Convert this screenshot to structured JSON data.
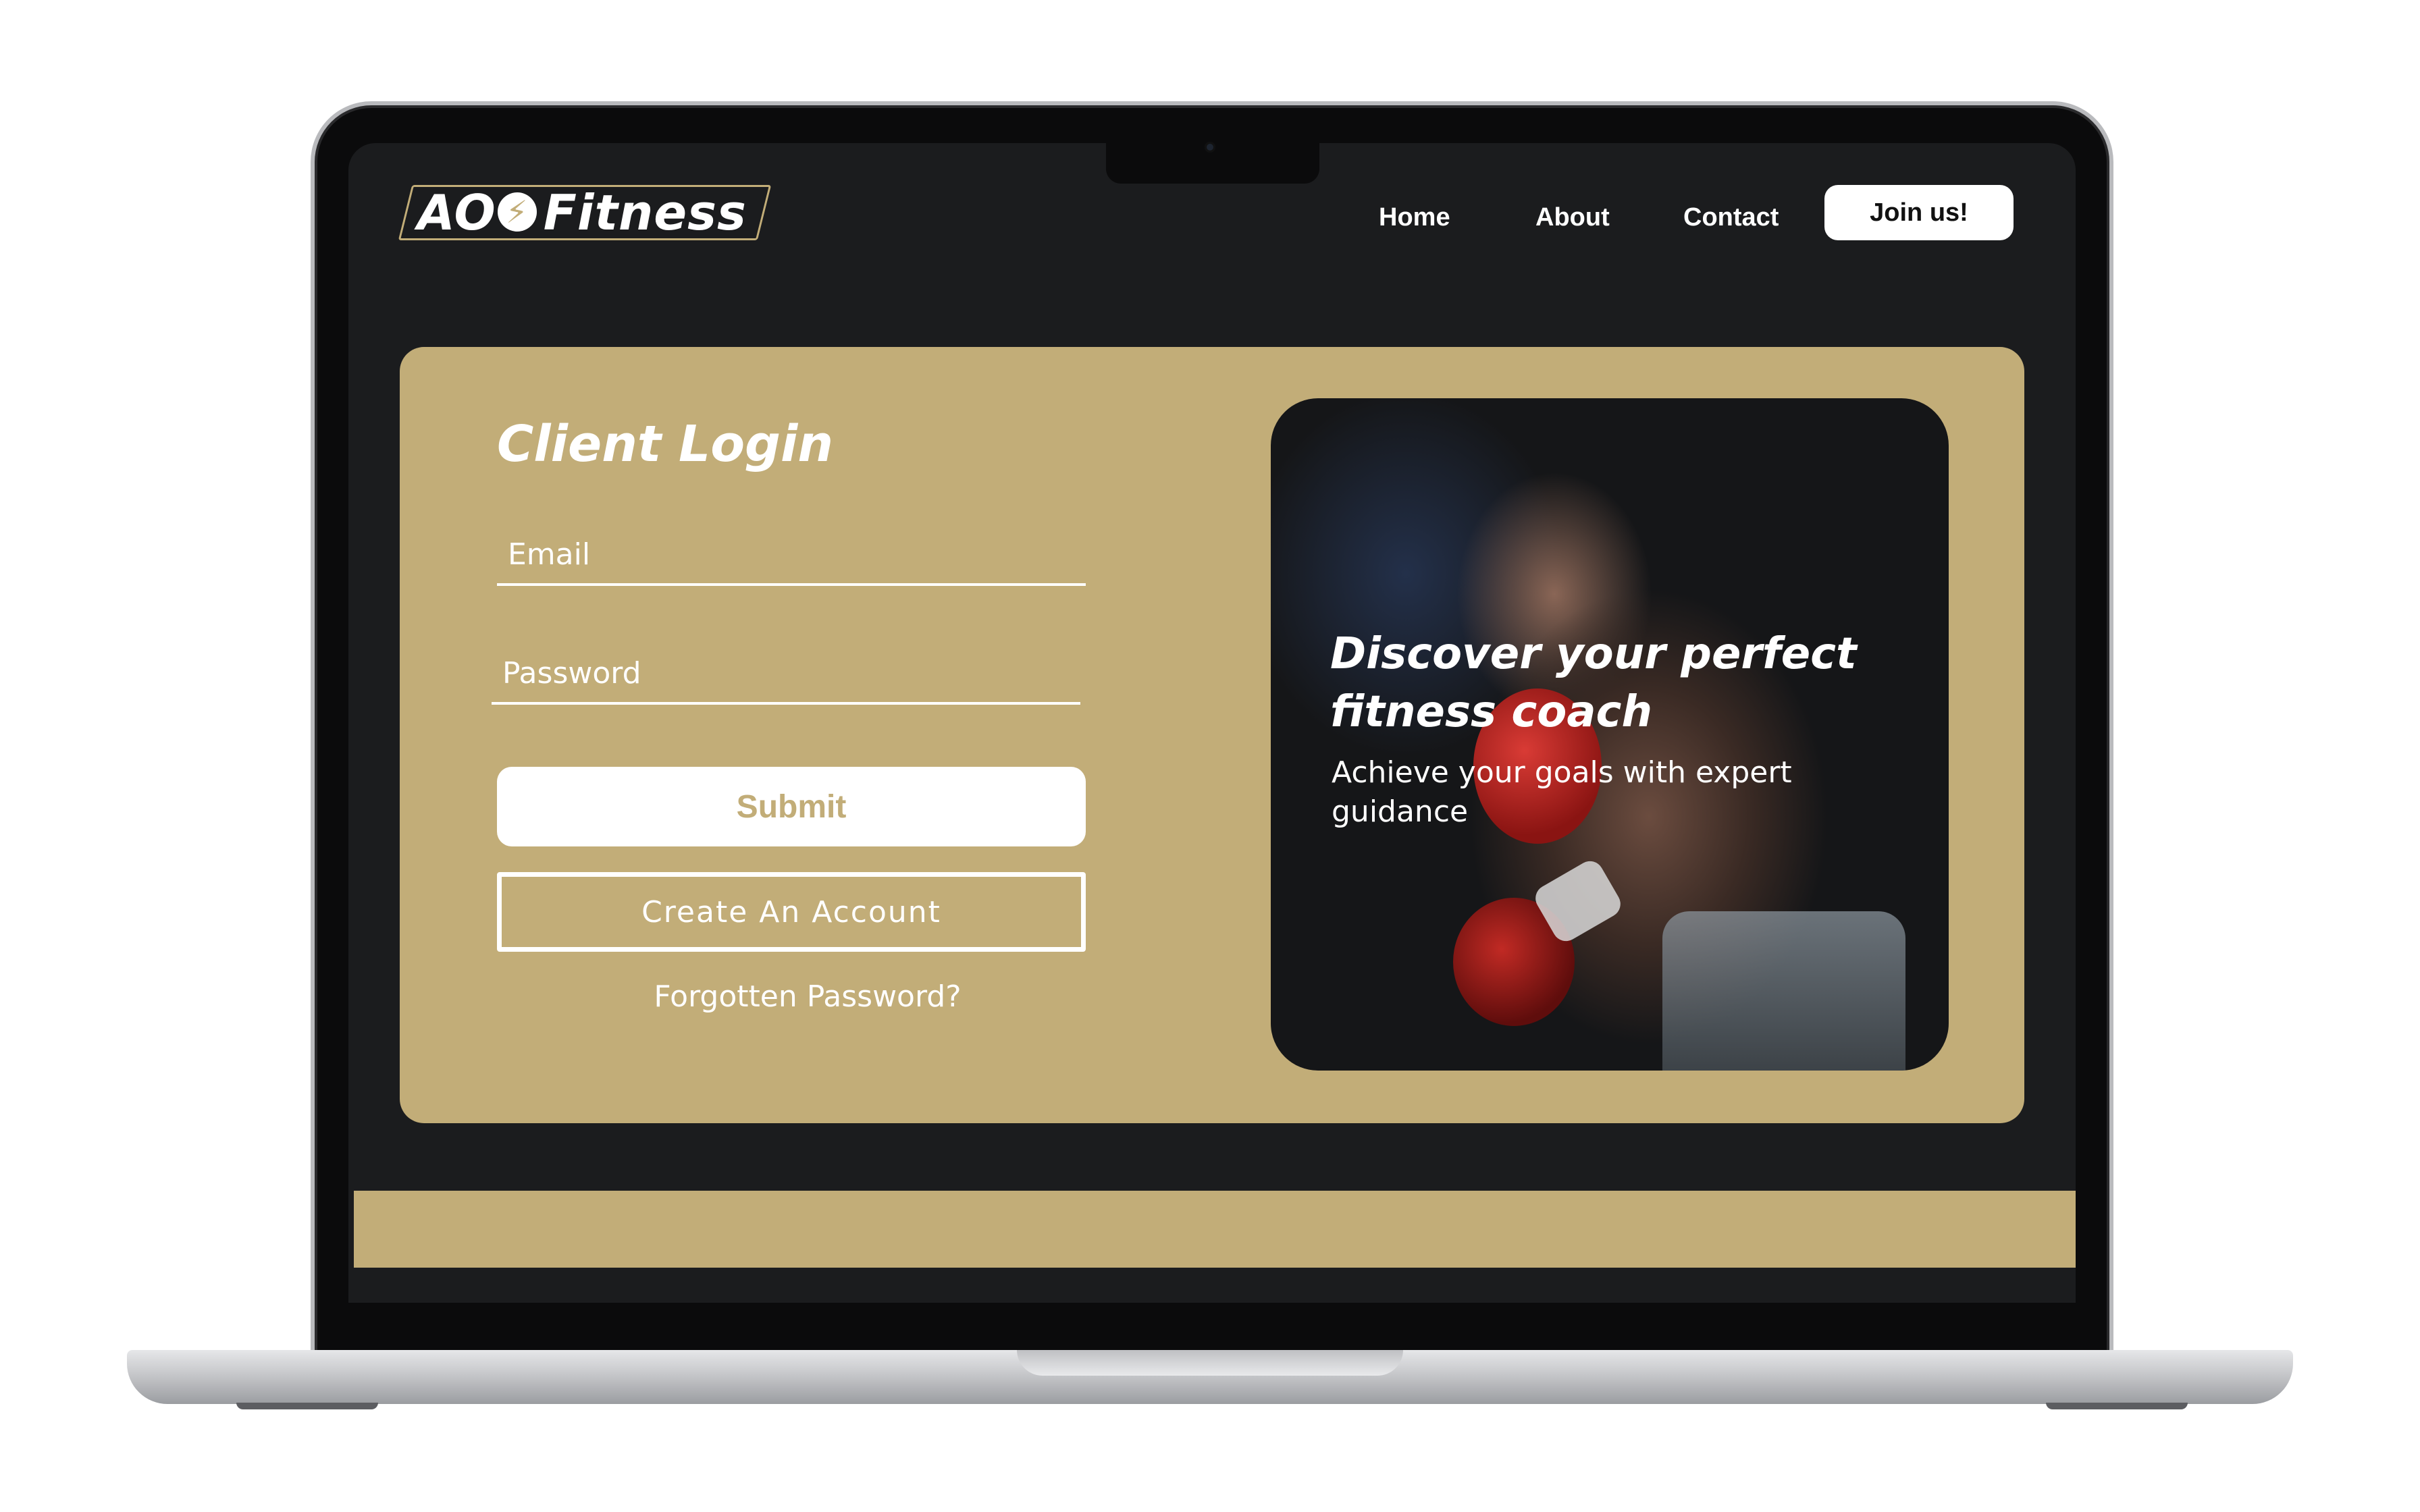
{
  "brand": {
    "logo_prefix": "AO",
    "logo_name": "Fitness",
    "accent_color": "#c2ad78",
    "background_color": "#1b1c1e",
    "bolt_icon": "lightning-bolt-icon"
  },
  "nav": {
    "items": [
      {
        "label": "Home"
      },
      {
        "label": "About"
      },
      {
        "label": "Contact"
      }
    ],
    "join_label": "Join us!"
  },
  "login": {
    "title": "Client Login",
    "email_placeholder": "Email",
    "password_placeholder": "Password",
    "submit_label": "Submit",
    "create_account_label": "Create An Account",
    "forgot_label": "Forgotten Password?"
  },
  "hero": {
    "heading": "Discover your perfect fitness coach",
    "subheading": "Achieve your goals with expert guidance"
  }
}
